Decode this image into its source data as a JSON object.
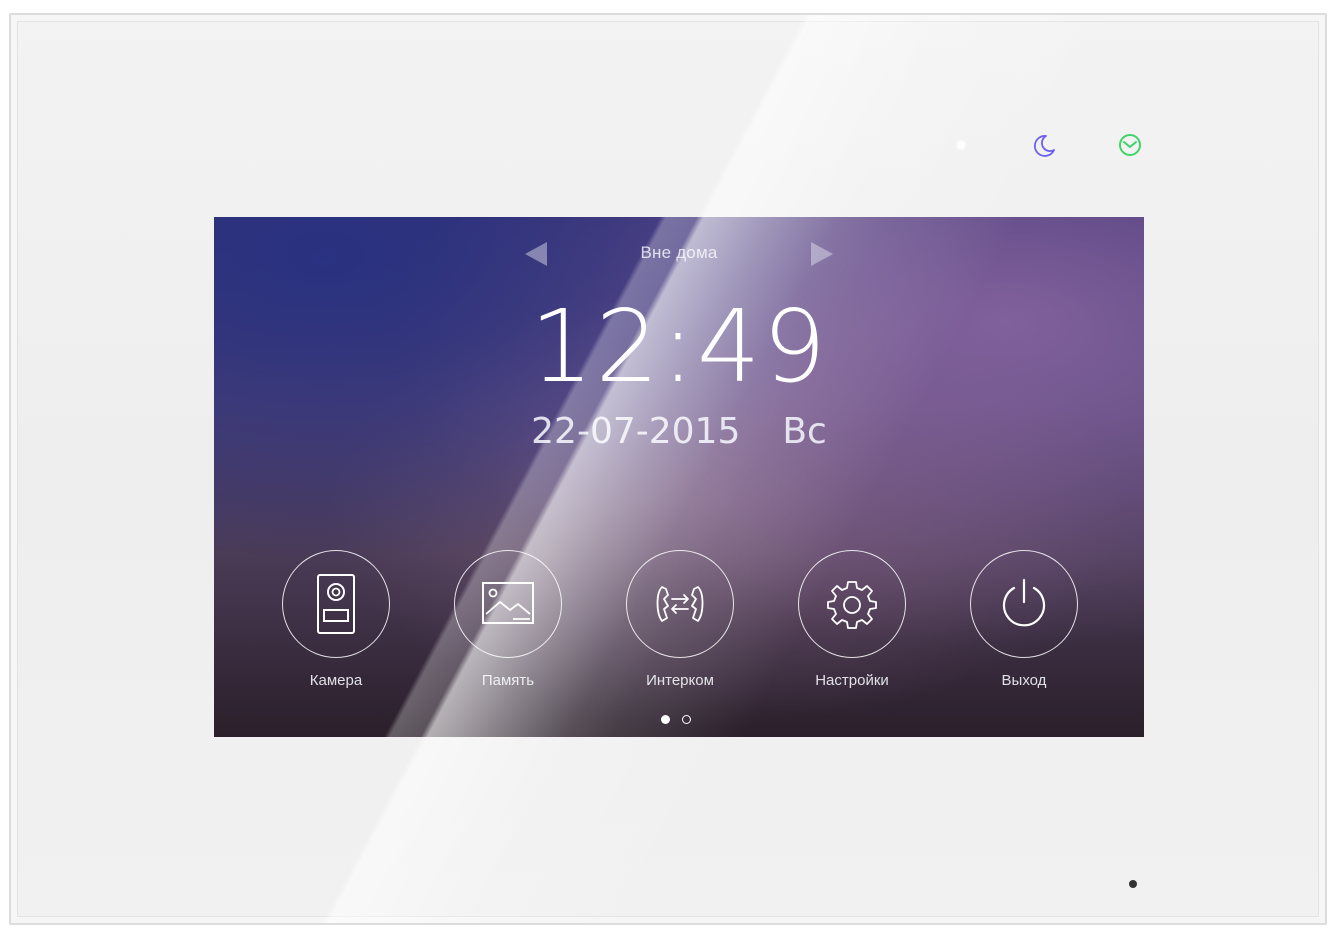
{
  "device": {
    "indicators": [
      {
        "name": "night-mode",
        "icon": "moon-icon",
        "color": "#6b5cf0"
      },
      {
        "name": "status",
        "icon": "status-icon",
        "color": "#3ed46a"
      }
    ]
  },
  "screen": {
    "mode": {
      "label": "Вне дома",
      "prev_icon": "arrow-left-icon",
      "next_icon": "arrow-right-icon"
    },
    "time": "12:49",
    "date": "22-07-2015",
    "weekday": "Вс",
    "menu": [
      {
        "id": "camera",
        "label": "Камера",
        "icon": "doorbell-camera-icon"
      },
      {
        "id": "memory",
        "label": "Память",
        "icon": "image-gallery-icon"
      },
      {
        "id": "intercom",
        "label": "Интерком",
        "icon": "intercom-phones-icon"
      },
      {
        "id": "settings",
        "label": "Настройки",
        "icon": "gear-icon"
      },
      {
        "id": "exit",
        "label": "Выход",
        "icon": "power-icon"
      }
    ],
    "pager": {
      "current": 1,
      "total": 2
    }
  }
}
